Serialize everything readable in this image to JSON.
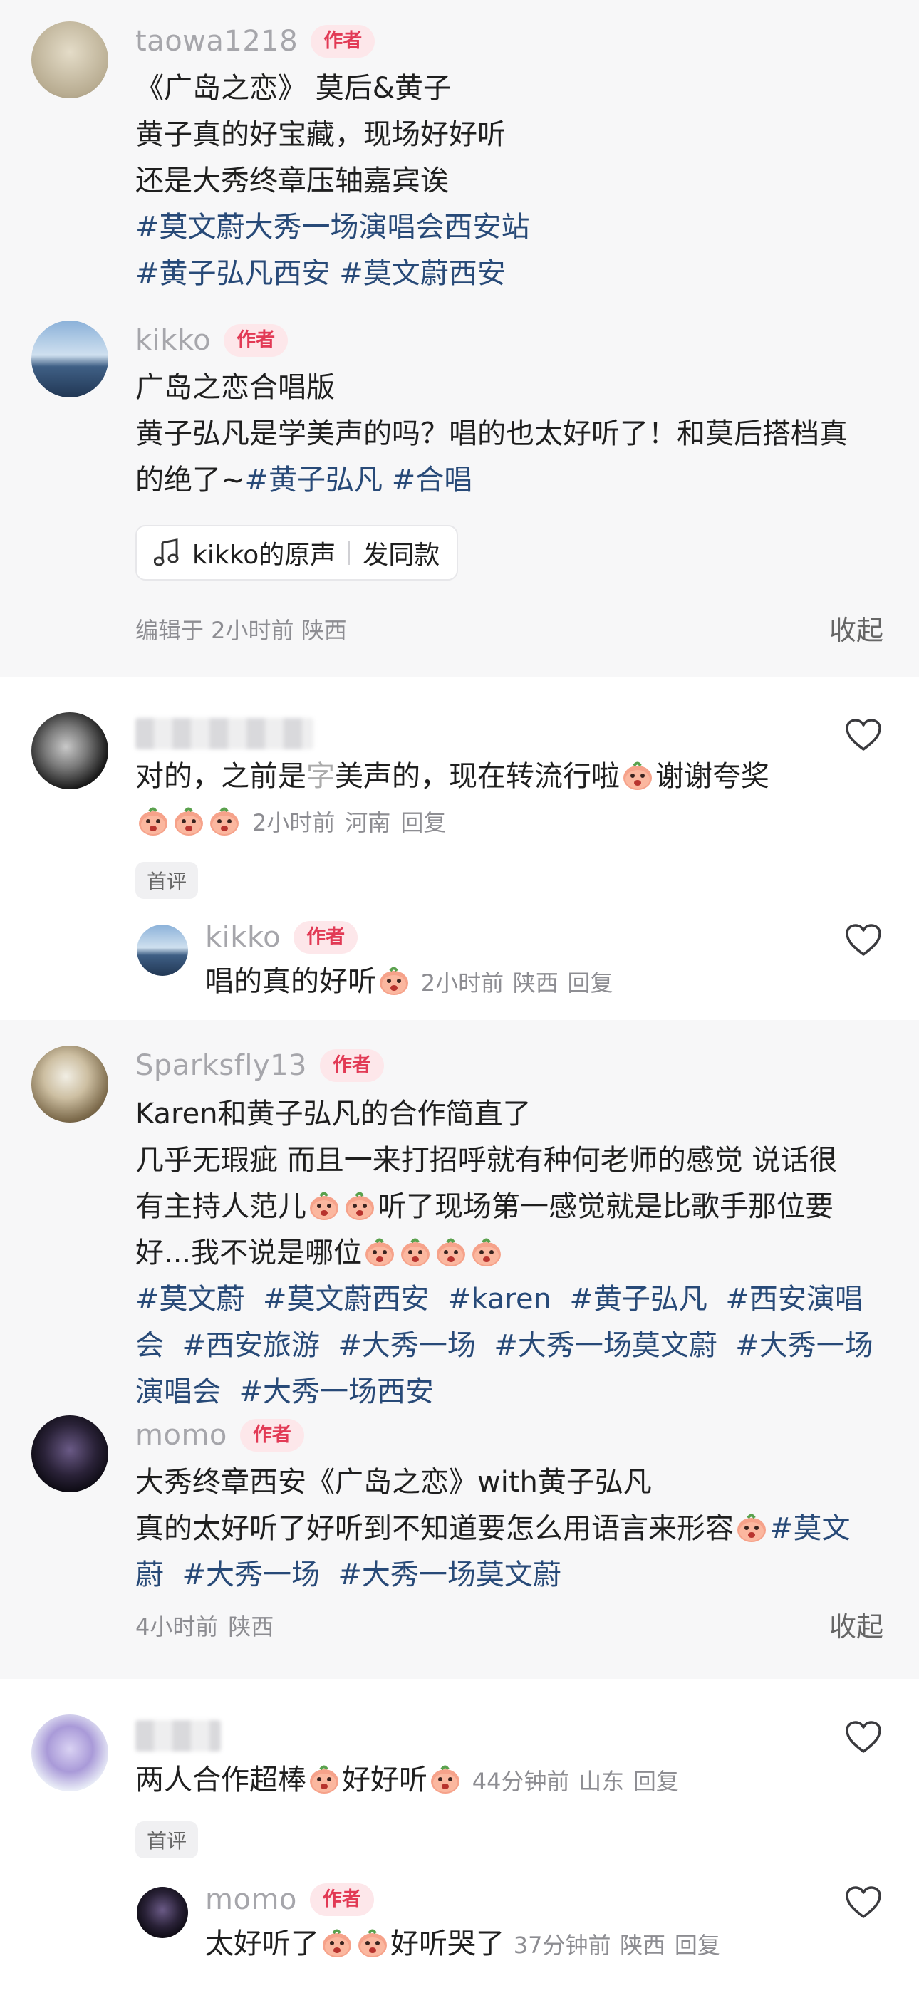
{
  "posts": [
    {
      "username": "taowa1218",
      "badge": "作者",
      "lines": [
        "《广岛之恋》 莫后&黄子",
        "黄子真的好宝藏，现场好好听",
        "还是大秀终章压轴嘉宾诶"
      ],
      "tags_line1": "#莫文蔚大秀一场演唱会西安站",
      "tags_line2a": "#黄子弘凡西安",
      "tags_line2b": "#莫文蔚西安"
    },
    {
      "username": "kikko",
      "badge": "作者",
      "line1": "广岛之恋合唱版",
      "line2": "黄子弘凡是学美声的吗？唱的也太好听了！和莫后搭档真",
      "line3_text": "的绝了~",
      "line3_tag1": "#黄子弘凡",
      "line3_tag2": "#合唱",
      "music_label": "kikko的原声",
      "music_action": "发同款",
      "meta": "编辑于  2小时前 陕西",
      "collapse": "收起"
    }
  ],
  "comment1": {
    "text_a": "对的，之前是",
    "text_b": "美声的，现在转流行啦",
    "text_c": "谢谢夸奖",
    "time": "2小时前",
    "location": "河南",
    "reply": "回复",
    "first_badge": "首评",
    "sub": {
      "username": "kikko",
      "badge": "作者",
      "text": "唱的真的好听",
      "time": "2小时前",
      "location": "陕西",
      "reply": "回复"
    }
  },
  "post3": {
    "username": "Sparksfly13",
    "badge": "作者",
    "line1": "Karen和黄子弘凡的合作简直了",
    "line2": "几乎无瑕疵 而且一来打招呼就有种何老师的感觉 说话很",
    "line3a": "有主持人范儿",
    "line3b": "听了现场第一感觉就是比歌手那位要",
    "line4": "好...我不说是哪位",
    "tags1": [
      "#莫文蔚",
      "#莫文蔚西安",
      "#karen",
      "#黄子弘凡",
      "#西安演唱"
    ],
    "tags2": [
      "会",
      "#西安旅游",
      "#大秀一场",
      "#大秀一场莫文蔚",
      "#大秀一场"
    ],
    "tags3": [
      "演唱会",
      "#大秀一场西安"
    ]
  },
  "post4": {
    "username": "momo",
    "badge": "作者",
    "line1": "大秀终章西安《广岛之恋》with黄子弘凡",
    "line2a": "真的太好听了好听到不知道要怎么用语言来形容",
    "line2b": "#莫文",
    "line3": [
      "蔚",
      "#大秀一场",
      "#大秀一场莫文蔚"
    ],
    "time": "4小时前",
    "location": "陕西",
    "collapse": "收起"
  },
  "comment2": {
    "text_a": "两人合作超棒",
    "text_b": "好好听",
    "time": "44分钟前",
    "location": "山东",
    "reply": "回复",
    "first_badge": "首评",
    "sub": {
      "username": "momo",
      "badge": "作者",
      "text_a": "太好听了",
      "text_b": "好听哭了",
      "time": "37分钟前",
      "location": "陕西",
      "reply": "回复"
    }
  },
  "colors": {
    "tag": "#284a78",
    "badge_bg": "#fde7ea",
    "badge_fg": "#e23a55",
    "gray_bg": "#f7f7f8"
  }
}
